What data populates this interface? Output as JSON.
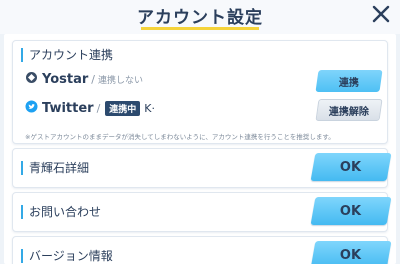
{
  "header": {
    "title": "アカウント設定",
    "close_icon": "close-icon"
  },
  "account_link": {
    "label": "アカウント連携",
    "yostar": {
      "icon": "yostar-icon",
      "name": "Yostar",
      "sep": "/",
      "status": "連携しない",
      "button": "連携"
    },
    "twitter": {
      "icon": "twitter-icon",
      "name": "Twitter",
      "sep": "/",
      "badge": "連携中",
      "handle": "K·",
      "button": "連携解除"
    },
    "note": "※ゲストアカウントのままデータが消失してしまわないように、アカウント連携を行うことを推奨します。"
  },
  "sections": [
    {
      "label": "青輝石詳細",
      "button": "OK"
    },
    {
      "label": "お問い合わせ",
      "button": "OK"
    },
    {
      "label": "バージョン情報",
      "button": "OK"
    }
  ],
  "colors": {
    "accent": "#33a9e6",
    "button_blue": "#4ec0f4",
    "title_underline": "#f5d33a",
    "badge": "#2c4a6e"
  }
}
